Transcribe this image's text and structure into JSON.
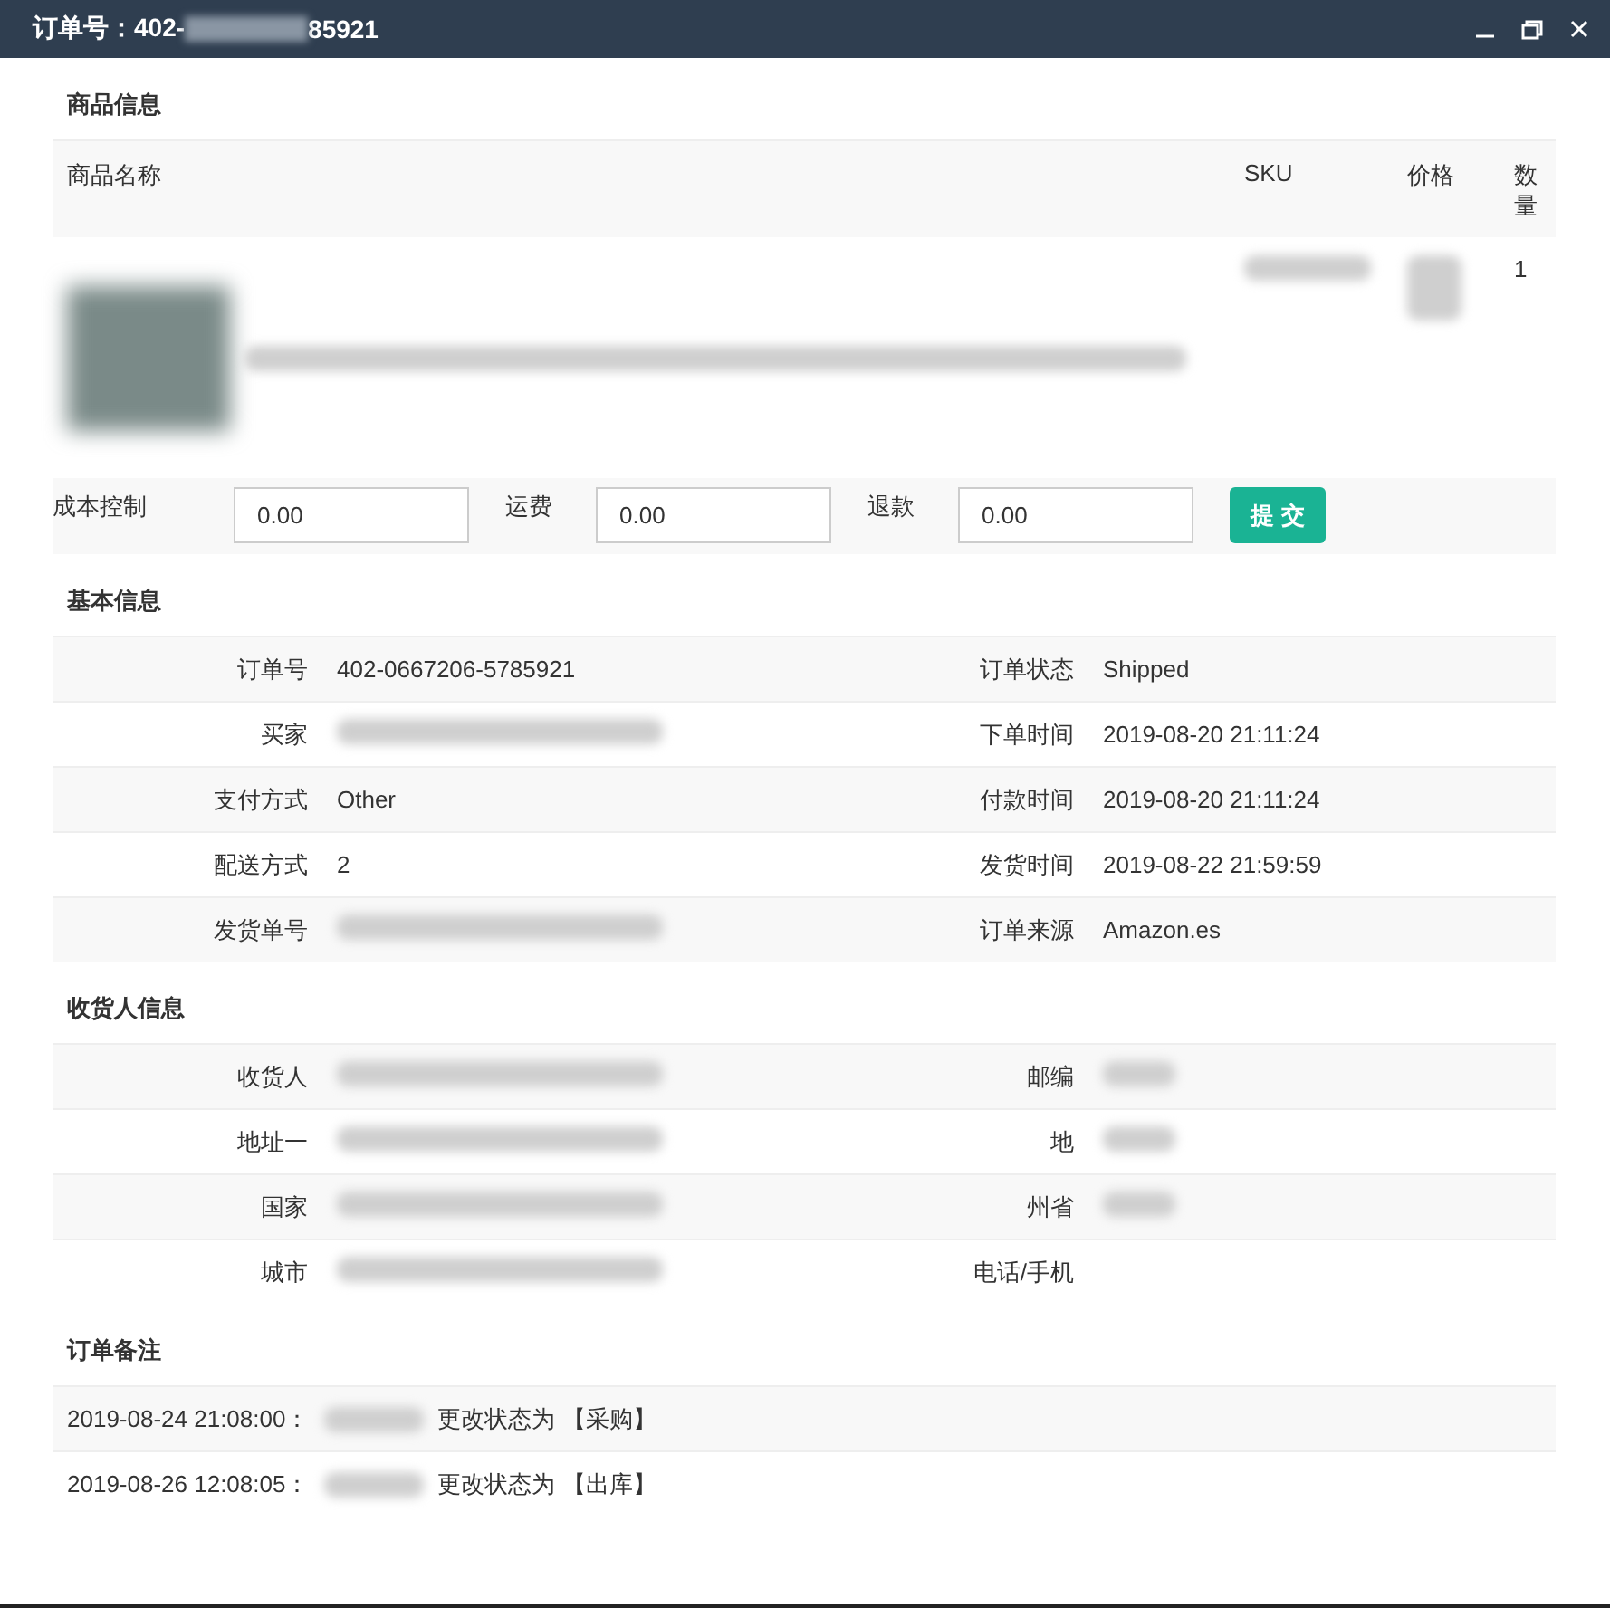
{
  "window": {
    "title_prefix": "订单号：402-",
    "title_redacted": true,
    "title_suffix": "85921",
    "controls": [
      {
        "kind": "minimize"
      },
      {
        "kind": "maximize"
      },
      {
        "kind": "close"
      }
    ]
  },
  "product_section": {
    "heading": "商品信息",
    "columns": [
      "商品名称",
      "SKU",
      "价格",
      "数量"
    ],
    "rows": [
      {
        "image_redacted": true,
        "name_redacted": true,
        "sku_redacted": true,
        "price_redacted": true,
        "quantity": "1"
      }
    ],
    "cost_fields": [
      {
        "label": "成本控制",
        "value": "0.00"
      },
      {
        "label": "运费",
        "value": "0.00"
      },
      {
        "label": "退款",
        "value": "0.00"
      }
    ],
    "submit": "提 交"
  },
  "basic_section": {
    "heading": "基本信息",
    "rows": [
      [
        {
          "label": "订单号",
          "value": "402-0667206-5785921"
        },
        {
          "label": "订单状态",
          "value": "Shipped"
        }
      ],
      [
        {
          "label": "买家",
          "redacted": true
        },
        {
          "label": "下单时间",
          "value": "2019-08-20 21:11:24"
        }
      ],
      [
        {
          "label": "支付方式",
          "value": "Other"
        },
        {
          "label": "付款时间",
          "value": "2019-08-20 21:11:24"
        }
      ],
      [
        {
          "label": "配送方式",
          "value": "2"
        },
        {
          "label": "发货时间",
          "value": "2019-08-22 21:59:59"
        }
      ],
      [
        {
          "label": "发货单号",
          "redacted": true
        },
        {
          "label": "订单来源",
          "value": "Amazon.es"
        }
      ]
    ]
  },
  "recipient_section": {
    "heading": "收货人信息",
    "rows": [
      [
        {
          "label": "收货人",
          "redacted": true
        },
        {
          "label": "邮编",
          "redacted": true
        }
      ],
      [
        {
          "label": "地址一",
          "redacted": true
        },
        {
          "label": "地",
          "redacted": true
        }
      ],
      [
        {
          "label": "国家",
          "redacted": true
        },
        {
          "label": "州省",
          "redacted": true
        }
      ],
      [
        {
          "label": "城市",
          "redacted": true
        },
        {
          "label": "电话/手机"
        }
      ]
    ]
  },
  "notes_section": {
    "heading": "订单备注",
    "notes": [
      {
        "time": "2019-08-24 21:08:00：",
        "user_redacted": true,
        "text": "更改状态为 【采购】"
      },
      {
        "time": "2019-08-26 12:08:05：",
        "user_redacted": true,
        "text": "更改状态为 【出库】"
      }
    ]
  }
}
